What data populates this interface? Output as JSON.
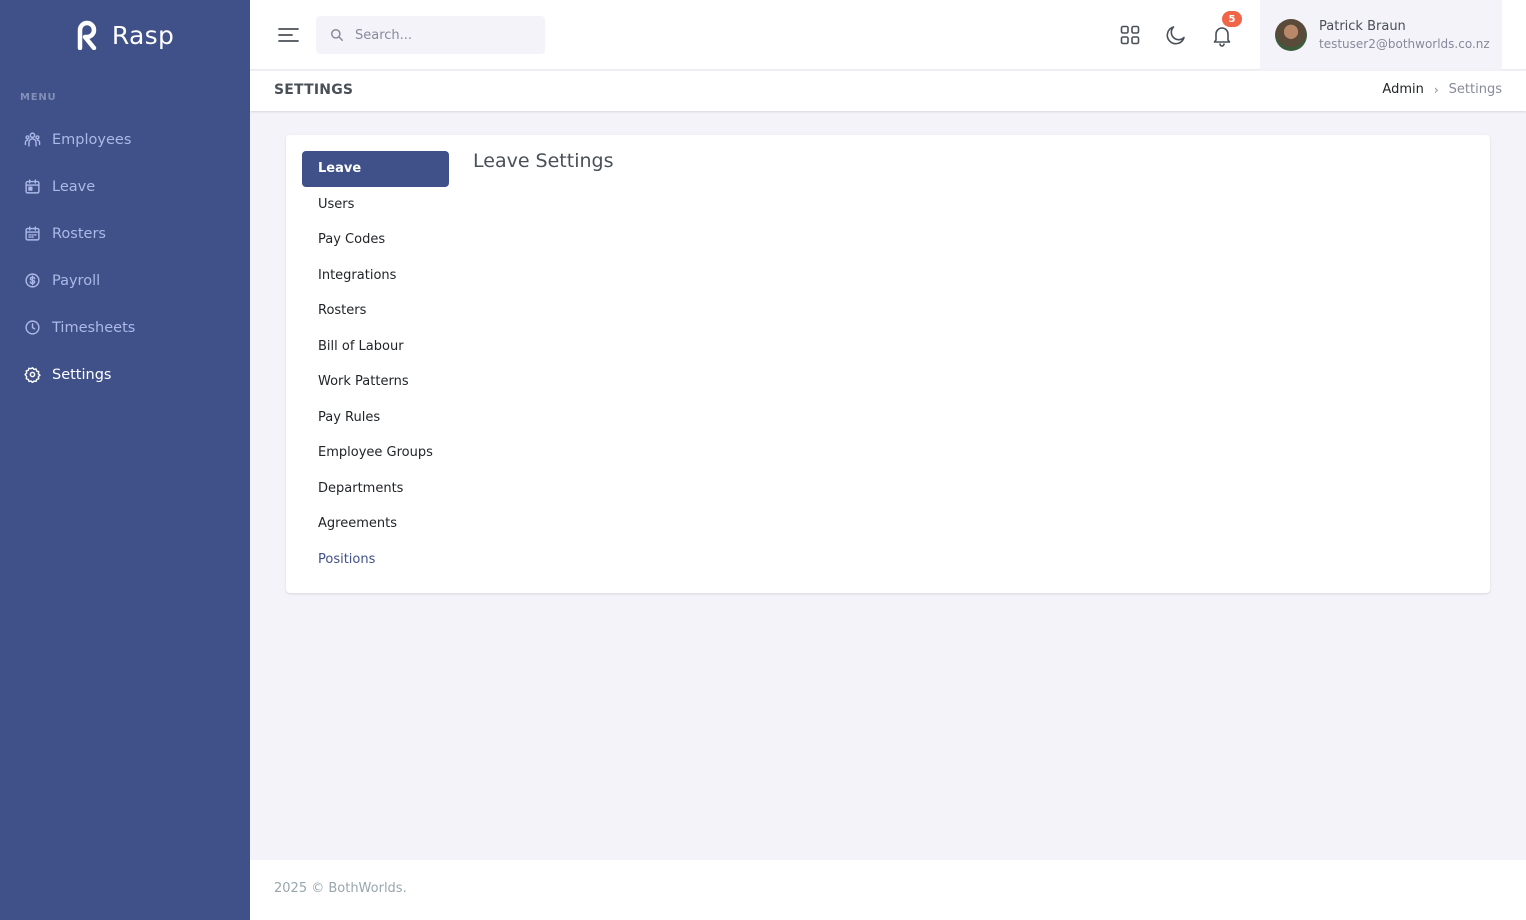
{
  "brand": {
    "name": "Rasp"
  },
  "sidebar": {
    "menu_title": "MENU",
    "items": [
      {
        "label": "Employees",
        "icon": "users-icon"
      },
      {
        "label": "Leave",
        "icon": "calendar-icon"
      },
      {
        "label": "Rosters",
        "icon": "calendar-grid-icon"
      },
      {
        "label": "Payroll",
        "icon": "dollar-circle-icon"
      },
      {
        "label": "Timesheets",
        "icon": "clock-icon"
      },
      {
        "label": "Settings",
        "icon": "gear-icon",
        "active": true
      }
    ]
  },
  "topbar": {
    "search_placeholder": "Search...",
    "notification_count": "5",
    "user": {
      "name": "Patrick Braun",
      "email": "testuser2@bothworlds.co.nz"
    }
  },
  "page": {
    "title": "SETTINGS",
    "breadcrumb": {
      "parent": "Admin",
      "current": "Settings"
    }
  },
  "settings": {
    "heading": "Leave Settings",
    "links": [
      "Leave",
      "Users",
      "Pay Codes",
      "Integrations",
      "Rosters",
      "Bill of Labour",
      "Work Patterns",
      "Pay Rules",
      "Employee Groups",
      "Departments",
      "Agreements",
      "Positions"
    ],
    "active": "Leave"
  },
  "footer": {
    "text": "2025 © BothWorlds."
  },
  "colors": {
    "sidebar": "#405189",
    "accent": "#405189",
    "badge": "#f06548"
  }
}
